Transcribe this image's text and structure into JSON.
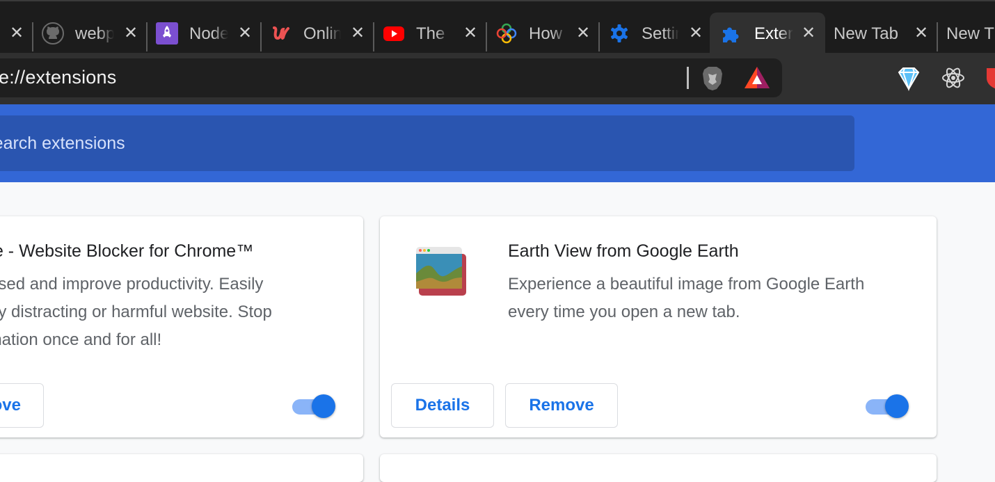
{
  "tabs": [
    {
      "title": "",
      "icon": "unknown-icon",
      "active": false
    },
    {
      "title": "webpack",
      "icon": "github-icon",
      "active": false
    },
    {
      "title": "Node",
      "icon": "rocket-icon",
      "active": false
    },
    {
      "title": "Online",
      "icon": "udemy-icon",
      "active": false
    },
    {
      "title": "The",
      "icon": "youtube-icon",
      "active": false
    },
    {
      "title": "How",
      "icon": "pinwheel-icon",
      "active": false
    },
    {
      "title": "Settings",
      "icon": "gear-icon",
      "active": false
    },
    {
      "title": "Extensions",
      "icon": "puzzle-icon",
      "active": true
    },
    {
      "title": "New Tab",
      "icon": "",
      "active": false
    },
    {
      "title": "New T",
      "icon": "",
      "active": false
    }
  ],
  "address_bar": {
    "url": "e://extensions"
  },
  "toolbar_icons": [
    "brave-lion-icon",
    "brave-rewards-icon",
    "diamond-extension-icon",
    "react-devtools-icon",
    "shield-extension-icon"
  ],
  "search": {
    "placeholder": "Search extensions"
  },
  "cards": [
    {
      "name": "te - Website Blocker for Chrome™",
      "description_lines": [
        "used and improve productivity. Easily",
        "ny distracting or harmful website. Stop",
        "ination once and for all!"
      ],
      "remove_label": "ove",
      "enabled": true
    },
    {
      "name": "Earth View from Google Earth",
      "description_lines": [
        "Experience a beautiful image from Google Earth",
        "every time you open a new tab."
      ],
      "details_label": "Details",
      "remove_label": "Remove",
      "enabled": true
    }
  ],
  "colors": {
    "accent": "#1a73e8",
    "header": "#3367d6",
    "toggle_track": "#8ab4f8"
  }
}
